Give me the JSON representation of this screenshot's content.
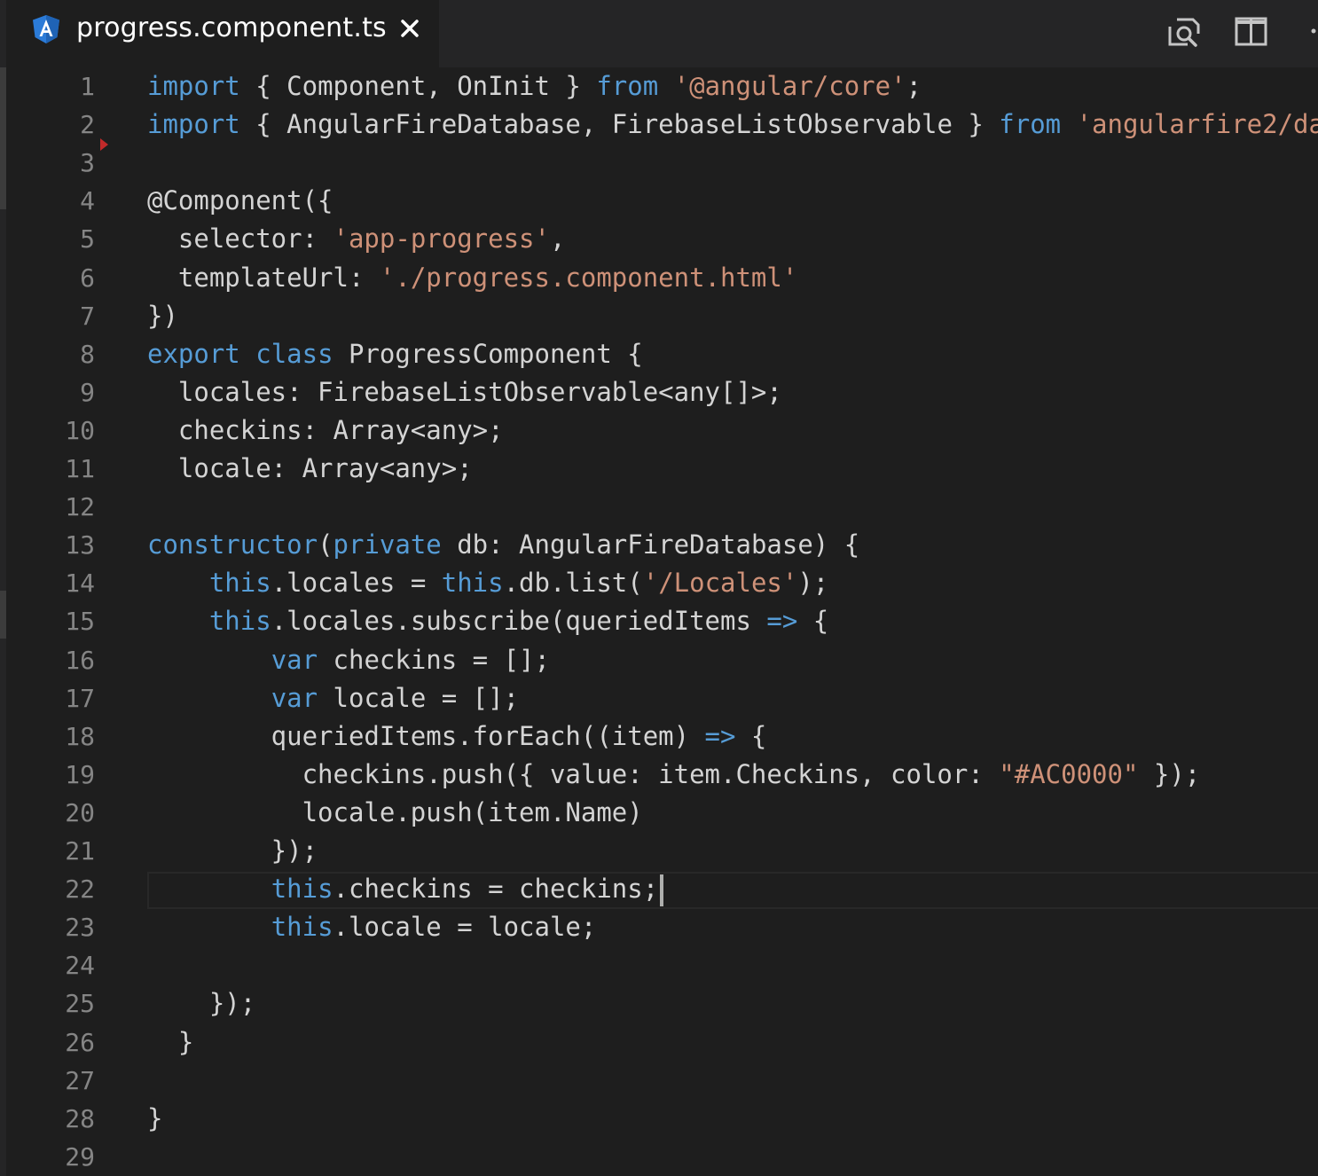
{
  "tab": {
    "filename": "progress.component.ts",
    "file_icon": "angular-icon",
    "close_icon": "close-icon"
  },
  "editor_actions": [
    {
      "icon": "open-preview-icon"
    },
    {
      "icon": "split-editor-icon"
    },
    {
      "icon": "more-actions-icon"
    }
  ],
  "colors": {
    "background": "#1e1e1e",
    "keyword": "#569cd6",
    "string": "#ce9178",
    "text": "#d4d4d4",
    "line_number": "#858585"
  },
  "line_numbers": [
    "1",
    "2",
    "3",
    "4",
    "5",
    "6",
    "7",
    "8",
    "9",
    "10",
    "11",
    "12",
    "13",
    "14",
    "15",
    "16",
    "17",
    "18",
    "19",
    "20",
    "21",
    "22",
    "23",
    "24",
    "25",
    "26",
    "27",
    "28",
    "29"
  ],
  "current_line": 22,
  "code_lines": [
    [
      [
        "kw",
        "import"
      ],
      [
        "txt",
        " { Component, OnInit } "
      ],
      [
        "kw",
        "from"
      ],
      [
        "txt",
        " "
      ],
      [
        "str",
        "'@angular/core'"
      ],
      [
        "txt",
        ";"
      ]
    ],
    [
      [
        "kw",
        "import"
      ],
      [
        "txt",
        " { AngularFireDatabase, FirebaseListObservable } "
      ],
      [
        "kw",
        "from"
      ],
      [
        "txt",
        " "
      ],
      [
        "str",
        "'angularfire2/da"
      ]
    ],
    [],
    [
      [
        "txt",
        "@Component({"
      ]
    ],
    [
      [
        "txt",
        "  selector: "
      ],
      [
        "str",
        "'app-progress'"
      ],
      [
        "txt",
        ","
      ]
    ],
    [
      [
        "txt",
        "  templateUrl: "
      ],
      [
        "str",
        "'./progress.component.html'"
      ]
    ],
    [
      [
        "txt",
        "})"
      ]
    ],
    [
      [
        "kw",
        "export"
      ],
      [
        "txt",
        " "
      ],
      [
        "kw",
        "class"
      ],
      [
        "txt",
        " ProgressComponent {"
      ]
    ],
    [
      [
        "txt",
        "  locales: FirebaseListObservable<any[]>;"
      ]
    ],
    [
      [
        "txt",
        "  checkins: Array<any>;"
      ]
    ],
    [
      [
        "txt",
        "  locale: Array<any>;"
      ]
    ],
    [],
    [
      [
        "kw",
        "constructor"
      ],
      [
        "txt",
        "("
      ],
      [
        "kw",
        "private"
      ],
      [
        "txt",
        " db: AngularFireDatabase) {"
      ]
    ],
    [
      [
        "txt",
        "    "
      ],
      [
        "kw",
        "this"
      ],
      [
        "txt",
        ".locales = "
      ],
      [
        "kw",
        "this"
      ],
      [
        "txt",
        ".db.list("
      ],
      [
        "str",
        "'/Locales'"
      ],
      [
        "txt",
        ");"
      ]
    ],
    [
      [
        "txt",
        "    "
      ],
      [
        "kw",
        "this"
      ],
      [
        "txt",
        ".locales.subscribe(queriedItems "
      ],
      [
        "kw",
        "=>"
      ],
      [
        "txt",
        " {"
      ]
    ],
    [
      [
        "txt",
        "        "
      ],
      [
        "kw",
        "var"
      ],
      [
        "txt",
        " checkins = [];"
      ]
    ],
    [
      [
        "txt",
        "        "
      ],
      [
        "kw",
        "var"
      ],
      [
        "txt",
        " locale = [];"
      ]
    ],
    [
      [
        "txt",
        "        queriedItems.forEach((item) "
      ],
      [
        "kw",
        "=>"
      ],
      [
        "txt",
        " {"
      ]
    ],
    [
      [
        "txt",
        "          checkins.push({ value: item.Checkins, color: "
      ],
      [
        "str",
        "\"#AC0000\""
      ],
      [
        "txt",
        " });"
      ]
    ],
    [
      [
        "txt",
        "          locale.push(item.Name)"
      ]
    ],
    [
      [
        "txt",
        "        });"
      ]
    ],
    [
      [
        "txt",
        "        "
      ],
      [
        "kw",
        "this"
      ],
      [
        "txt",
        ".checkins = checkins;"
      ]
    ],
    [
      [
        "txt",
        "        "
      ],
      [
        "kw",
        "this"
      ],
      [
        "txt",
        ".locale = locale;"
      ]
    ],
    [],
    [
      [
        "txt",
        "    });"
      ]
    ],
    [
      [
        "txt",
        "  }"
      ]
    ],
    [],
    [
      [
        "txt",
        "}"
      ]
    ],
    []
  ]
}
